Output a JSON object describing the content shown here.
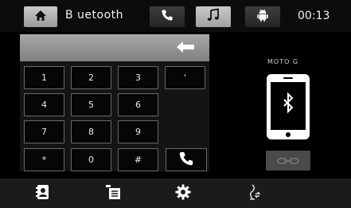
{
  "header": {
    "title": "B uetooth",
    "clock": "00:13",
    "home_icon": "home-icon",
    "tabs": [
      {
        "name": "phone",
        "icon": "phone-icon",
        "active": false
      },
      {
        "name": "music",
        "icon": "music-note-icon",
        "active": true
      },
      {
        "name": "android",
        "icon": "android-icon",
        "active": false
      }
    ]
  },
  "keypad": {
    "display_value": "",
    "backspace_icon": "backspace-arrow-icon",
    "keys": [
      "1",
      "2",
      "3",
      "4",
      "5",
      "6",
      "7",
      "8",
      "9",
      "*",
      "0",
      "#"
    ],
    "extra_key": "'",
    "call_icon": "call-icon"
  },
  "device": {
    "name": "MOTO G",
    "icon": "smartphone-bluetooth-icon",
    "connect_icon": "link-icon"
  },
  "footer": {
    "items": [
      {
        "name": "contacts",
        "icon": "contacts-icon"
      },
      {
        "name": "call-log",
        "icon": "call-log-icon"
      },
      {
        "name": "settings",
        "icon": "gear-icon"
      },
      {
        "name": "audio-transfer",
        "icon": "audio-transfer-icon"
      }
    ]
  },
  "colors": {
    "background": "#000000",
    "active_tab": "#c9c9c9",
    "inactive_tab": "#333333",
    "display": "#9a9a9a"
  }
}
